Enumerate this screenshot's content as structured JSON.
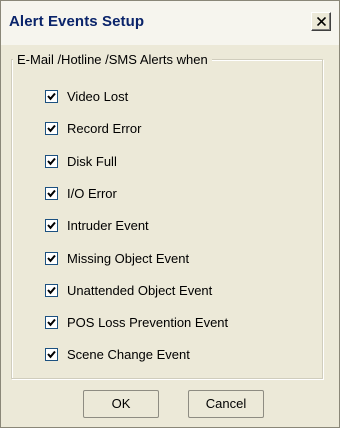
{
  "window": {
    "title": "Alert Events Setup"
  },
  "group": {
    "legend": "E-Mail /Hotline /SMS Alerts when"
  },
  "options": [
    {
      "label": "Video Lost",
      "checked": true
    },
    {
      "label": "Record Error",
      "checked": true
    },
    {
      "label": "Disk Full",
      "checked": true
    },
    {
      "label": "I/O Error",
      "checked": true
    },
    {
      "label": "Intruder Event",
      "checked": true
    },
    {
      "label": "Missing Object Event",
      "checked": true
    },
    {
      "label": "Unattended Object Event",
      "checked": true
    },
    {
      "label": "POS Loss Prevention Event",
      "checked": true
    },
    {
      "label": "Scene Change Event",
      "checked": true
    }
  ],
  "buttons": {
    "ok_label": "OK",
    "cancel_label": "Cancel"
  },
  "icons": {
    "close": "close-icon",
    "check": "checkmark-icon"
  },
  "colors": {
    "title_text": "#0a246a",
    "dialog_bg": "#ece9d8",
    "checkbox_border": "#1c5180"
  }
}
